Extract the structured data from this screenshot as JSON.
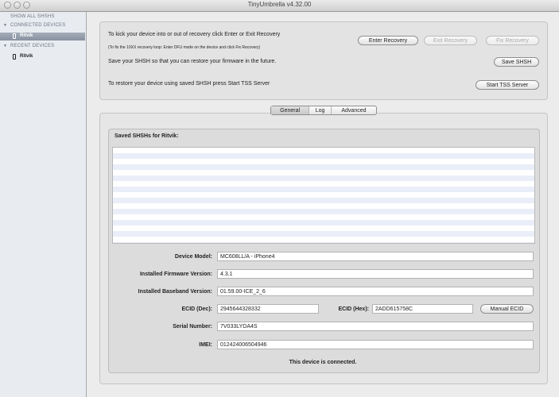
{
  "window": {
    "title": "TinyUmbrella v4.32.00"
  },
  "sidebar": {
    "show_all": "SHOW ALL SHSHS",
    "connected_header": "CONNECTED DEVICES",
    "connected_items": [
      "Ritvik"
    ],
    "recent_header": "RECENT DEVICES",
    "recent_items": [
      "Ritvik"
    ]
  },
  "recovery": {
    "line1": "To kick your device into or out of recovery click Enter or Exit Recovery",
    "line2": "(To fix the 10XX recovery loop: Enter DFU mode on the device and click Fix Recovery)",
    "line3": "Save your SHSH so that you can restore your firmware in the future.",
    "line4": "To restore your device using saved SHSH press Start TSS Server",
    "enter_label": "Enter Recovery",
    "exit_label": "Exit Recovery",
    "fix_label": "Fix Recovery",
    "save_label": "Save SHSH",
    "tss_label": "Start TSS Server"
  },
  "tabs": [
    "General",
    "Log",
    "Advanced"
  ],
  "general": {
    "saved_title": "Saved SHSHs for Ritvik:",
    "device_model_label": "Device Model:",
    "device_model": "MC608LL/A - iPhone4",
    "firmware_label": "Installed Firmware Version:",
    "firmware": "4.3.1",
    "baseband_label": "Installed Baseband Version:",
    "baseband": "01.59.00-ICE_2_6",
    "ecid_dec_label": "ECID (Dec):",
    "ecid_dec": "2945644328332",
    "ecid_hex_label": "ECID (Hex):",
    "ecid_hex": "2ADD615758C",
    "manual_ecid_label": "Manual ECID",
    "serial_label": "Serial Number:",
    "serial": "7V033LYDA4S",
    "imei_label": "IMEI:",
    "imei": "012424006504946",
    "status": "This device is connected."
  }
}
